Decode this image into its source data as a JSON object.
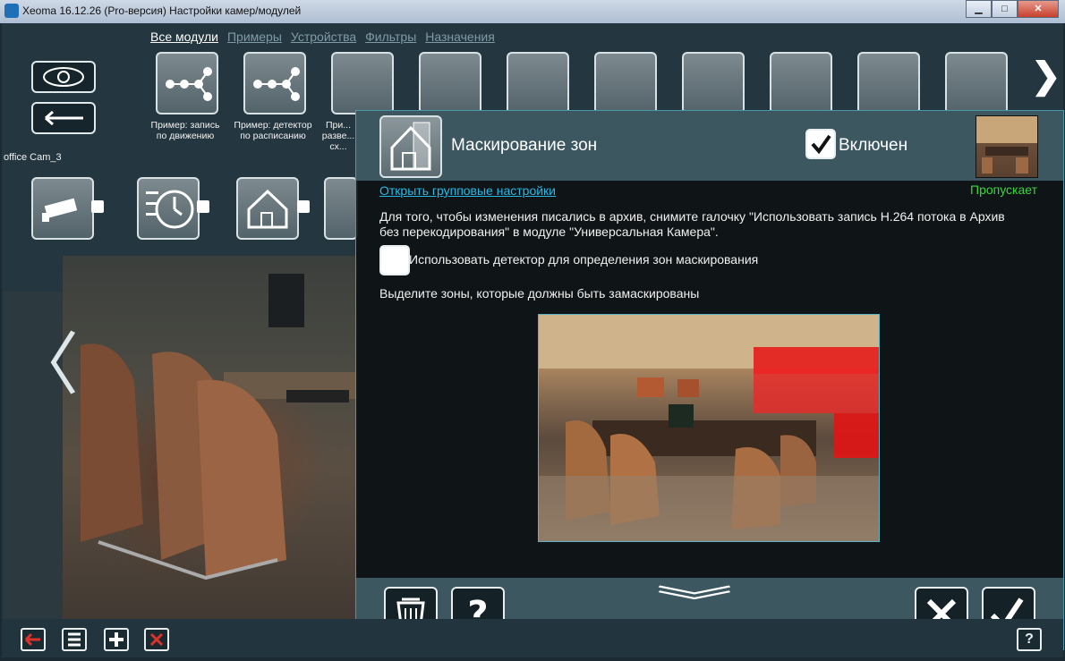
{
  "window": {
    "title": "Xeoma 16.12.26 (Pro-версия) Настройки камер/модулей",
    "minimize": "▁",
    "maximize": "□",
    "close": "✕"
  },
  "nav": {
    "tabs": [
      "Все модули",
      "Примеры",
      "Устройства",
      "Фильтры",
      "Назначения"
    ]
  },
  "modules": [
    {
      "label": "Пример: запись по движению"
    },
    {
      "label": "Пример: детектор по расписанию"
    },
    {
      "label": "При... разве... сх..."
    }
  ],
  "camera": {
    "name": "office Cam_3"
  },
  "dialog": {
    "title": "Маскирование зон",
    "enabled_label": "Включен",
    "enabled": true,
    "group_settings_link": "Открыть групповые настройки",
    "status": "Пропускает",
    "info_line1": "Для того, чтобы изменения писались в архив, снимите галочку \"Использовать запись H.264 потока в Архив",
    "info_line2": "без перекодирования\" в модуле \"Универсальная Камера\".",
    "detector_label": "Использовать детектор для определения зон маскирования",
    "detector_checked": false,
    "zones_instruction": "Выделите зоны, которые должны быть замаскированы",
    "ok_label": "ok"
  },
  "bottom": {
    "help_label": "?"
  },
  "colors": {
    "accent_link": "#29b7e6",
    "status_green": "#39d63a",
    "mask_red": "#e61414"
  }
}
